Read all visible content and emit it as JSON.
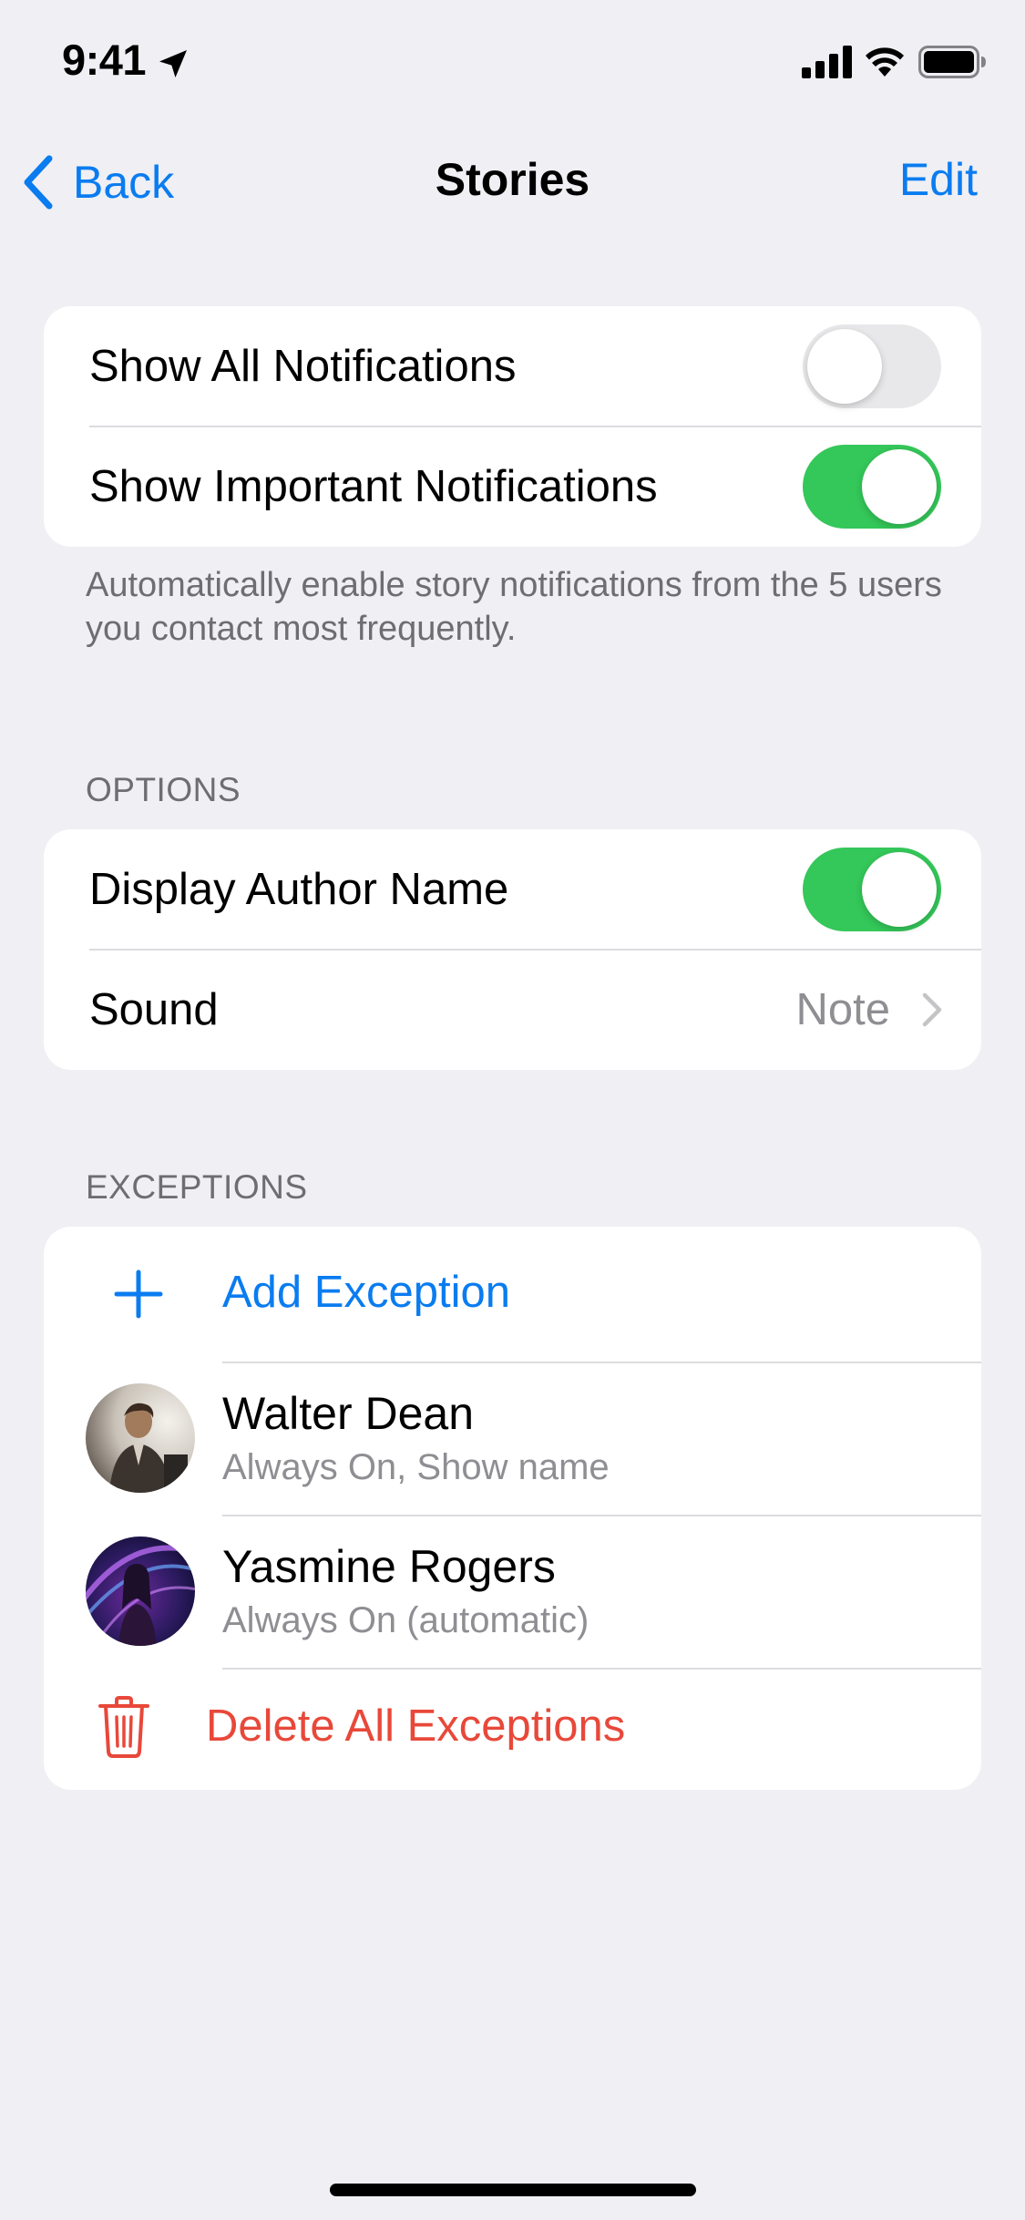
{
  "status_bar": {
    "time": "9:41"
  },
  "nav": {
    "back_label": "Back",
    "title": "Stories",
    "edit_label": "Edit"
  },
  "notifications": {
    "show_all": {
      "label": "Show All Notifications",
      "on": false
    },
    "show_important": {
      "label": "Show Important Notifications",
      "on": true
    },
    "footnote": "Automatically enable story notifications from the 5 users you contact most frequently."
  },
  "options": {
    "header": "OPTIONS",
    "display_author": {
      "label": "Display Author Name",
      "on": true
    },
    "sound": {
      "label": "Sound",
      "value": "Note"
    }
  },
  "exceptions": {
    "header": "EXCEPTIONS",
    "add_label": "Add Exception",
    "people": [
      {
        "name": "Walter Dean",
        "status": "Always On, Show name"
      },
      {
        "name": "Yasmine Rogers",
        "status": "Always On (automatic)"
      }
    ],
    "delete_label": "Delete All Exceptions"
  },
  "colors": {
    "accent": "#0a7cf0",
    "toggle_on": "#34c759",
    "destructive": "#e8483a",
    "background": "#efeff4"
  }
}
